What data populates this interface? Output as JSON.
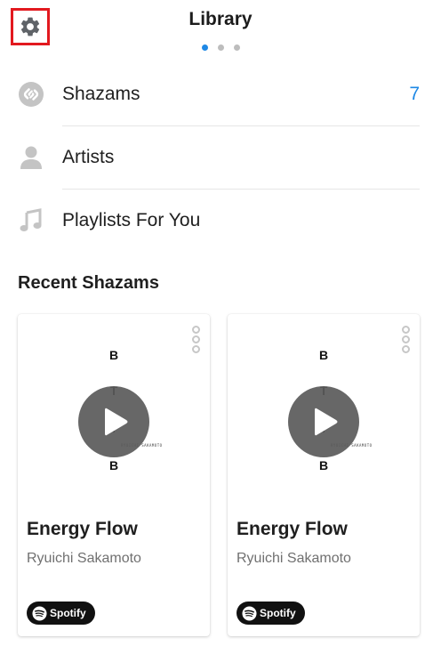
{
  "header": {
    "title": "Library",
    "settings_icon": "gear-icon",
    "pages": 3,
    "active_page": 1
  },
  "library": [
    {
      "label": "Shazams",
      "icon": "shazam-logo-icon",
      "count": "7"
    },
    {
      "label": "Artists",
      "icon": "person-icon",
      "count": ""
    },
    {
      "label": "Playlists For You",
      "icon": "music-note-icon",
      "count": ""
    }
  ],
  "recent": {
    "title": "Recent Shazams",
    "cards": [
      {
        "title": "Energy Flow",
        "artist": "Ryuichi Sakamoto",
        "art_letters": [
          "B",
          "T",
          "T",
          "B"
        ],
        "art_credit": "RYUICHI SAKAMOTO",
        "provider": "Spotify"
      },
      {
        "title": "Energy Flow",
        "artist": "Ryuichi Sakamoto",
        "art_letters": [
          "B",
          "T",
          "T",
          "B"
        ],
        "art_credit": "RYUICHI SAKAMOTO",
        "provider": "Spotify"
      }
    ]
  },
  "colors": {
    "accent": "#1e88e5",
    "highlight_box": "#e2191f",
    "icon_gray": "#c4c4c4"
  }
}
